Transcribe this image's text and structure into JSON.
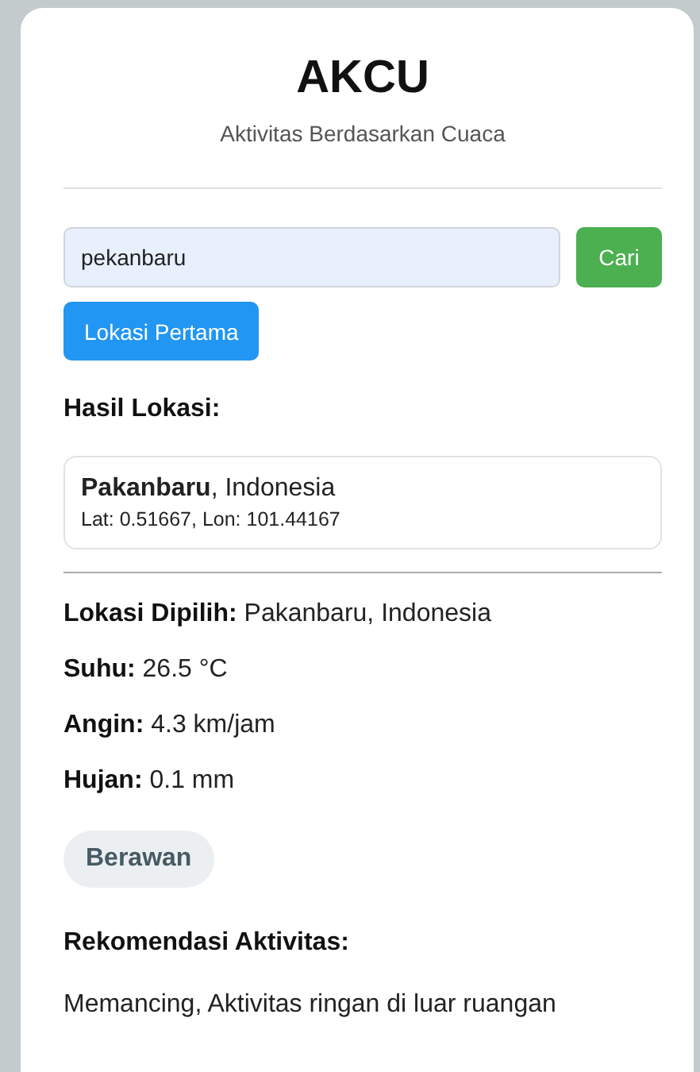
{
  "app": {
    "title": "AKCU",
    "subtitle": "Aktivitas Berdasarkan Cuaca"
  },
  "search": {
    "value": "pekanbaru",
    "button": "Cari"
  },
  "first_location_button": "Lokasi Pertama",
  "results_heading": "Hasil Lokasi:",
  "results": [
    {
      "name": "**Pakanbaru**, Indonesia",
      "coords": "Lat: 0.51667, Lon: 101.44167"
    }
  ],
  "details": [
    {
      "label": "Lokasi Dipilih:",
      "value": "Pakanbaru, Indonesia"
    },
    {
      "label": "Suhu:",
      "value": "26.5 °C"
    },
    {
      "label": "Angin:",
      "value": "4.3 km/jam"
    },
    {
      "label": "Hujan:",
      "value": "0.1 mm"
    }
  ],
  "condition_badge": "Berawan",
  "recommendation": {
    "heading": "Rekomendasi Aktivitas:",
    "text": "Memancing, Aktivitas ringan di luar ruangan"
  }
}
